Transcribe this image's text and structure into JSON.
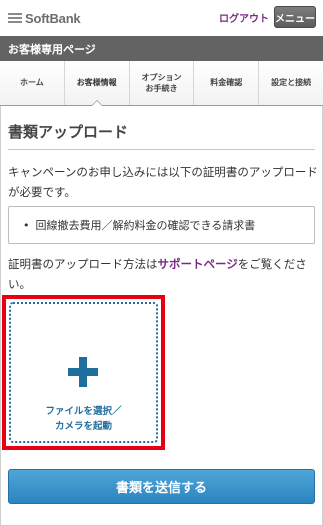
{
  "header": {
    "logo_text": "SoftBank",
    "logout_label": "ログアウト",
    "menu_label": "メニュー"
  },
  "page_header": {
    "title": "お客様専用ページ"
  },
  "tabs": [
    {
      "label": "ホーム",
      "active": false
    },
    {
      "label": "お客様情報",
      "active": true
    },
    {
      "label": "オプション\nお手続き",
      "active": false
    },
    {
      "label": "料金確認",
      "active": false
    },
    {
      "label": "設定と接続",
      "active": false
    }
  ],
  "main": {
    "title": "書類アップロード",
    "description": "キャンペーンのお申し込みには以下の証明書のアップロードが必要です。",
    "documents": [
      {
        "bullet": "•",
        "label": "回線撤去費用／解約料金の確認できる請求書"
      }
    ],
    "method_prefix": "証明書のアップロード方法は",
    "method_link": "サポートページ",
    "method_suffix": "をご覧ください。",
    "upload": {
      "line1": "ファイルを選択／",
      "line2": "カメラを起動"
    },
    "submit_label": "書類を送信する"
  },
  "colors": {
    "accent_purple": "#7a2a83",
    "upload_blue": "#1f6f9e",
    "highlight_red": "#e60012",
    "submit_blue": "#2b84c0",
    "header_gray": "#636363"
  },
  "icons": {
    "logo": "softbank-bars-icon",
    "upload": "plus-icon"
  }
}
